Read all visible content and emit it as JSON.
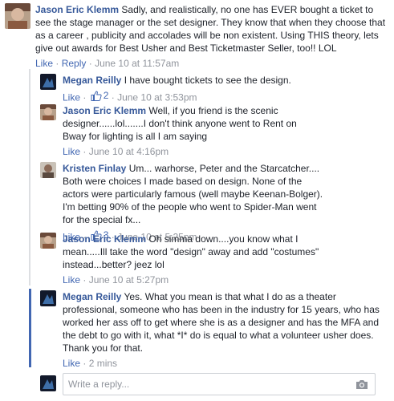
{
  "comments": [
    {
      "author": "Jason Eric Klemm",
      "text": "Sadly, and realistically, no one has EVER bought a ticket to see the stage manager or the set designer. They know that when they choose that as a career , publicity and accolades will be non existent. Using THIS theory, lets give out awards for Best Usher and Best Ticketmaster Seller, too!! LOL",
      "like": "Like",
      "reply": "Reply",
      "time": "June 10 at 11:57am"
    }
  ],
  "replies": [
    {
      "author": "Megan Reilly",
      "text": "I have bought tickets to see the design.",
      "like": "Like",
      "likes": "2",
      "time": "June 10 at 3:53pm"
    },
    {
      "author": "Jason Eric Klemm",
      "text": "Well, if you friend is the scenic designer......lol.......I don't think anyone went to Rent on Bway for lighting is all I am saying",
      "like": "Like",
      "time": "June 10 at 4:16pm"
    },
    {
      "author": "Kristen Finlay",
      "text": "Um... warhorse, Peter and the Starcatcher.... Both were choices I made based on design. None of the actors were particularly famous (well maybe Keenan-Bolger). I'm betting 90% of the people who went to Spider-Man went for the special fx...",
      "like": "Like",
      "likes": "3",
      "time": "June 10 at 5:25pm"
    },
    {
      "author": "Jason Eric Klemm",
      "text": "Oh simma down....you know what I mean.....Ill take the word \"design\" away and add \"costumes\" instead...better? jeez lol",
      "like": "Like",
      "time": "June 10 at 5:27pm"
    },
    {
      "author": "Megan Reilly",
      "text": "Yes. What you mean is that what I do as a theater professional, someone who has been in the industry for 15 years, who has worked her ass off to get where she is as a designer and has the MFA and the debt to go with it, what *I* do is equal to what a volunteer usher does. Thank you for that.",
      "like": "Like",
      "time": "2 mins"
    }
  ],
  "composer": {
    "placeholder": "Write a reply..."
  },
  "colors": {
    "link": "#365899",
    "meta": "#90949c",
    "accent": "#4267b2"
  }
}
